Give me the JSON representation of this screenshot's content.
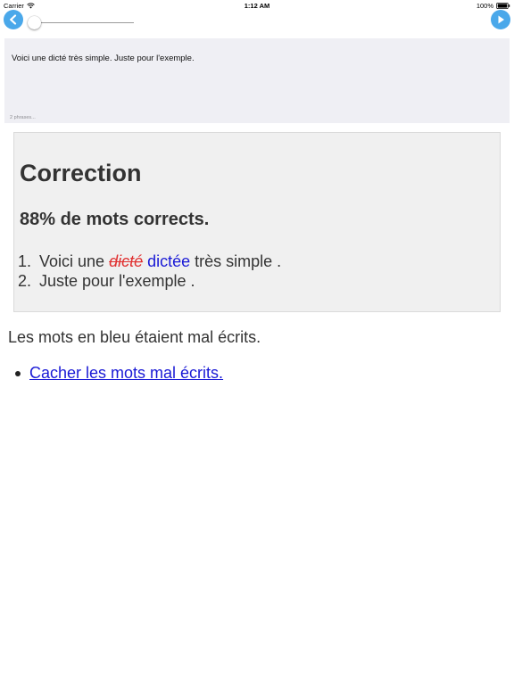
{
  "status_bar": {
    "carrier": "Carrier",
    "time": "1:12 AM",
    "battery": "100%"
  },
  "toolbar": {
    "back_icon": "chevron-left",
    "forward_icon": "play-triangle",
    "accent_color": "#4aa8ea",
    "slider_value": 0
  },
  "dictee": {
    "text": "Voici une dicté très simple. Juste pour l'exemple.",
    "count": "2 phrases..."
  },
  "correction": {
    "title": "Correction",
    "score": "88% de mots corrects.",
    "sentences": [
      {
        "number": "1.",
        "before": "Voici une ",
        "wrong": "dicté",
        "right": "dictée",
        "after": " très simple ."
      },
      {
        "number": "2.",
        "text": "Juste pour l'exemple ."
      }
    ]
  },
  "note": "Les mots en bleu étaient mal écrits.",
  "links": {
    "hide_errors": "Cacher les mots mal écrits."
  },
  "colors": {
    "wrong": "#e03030",
    "corrected": "#1a1ad6"
  }
}
